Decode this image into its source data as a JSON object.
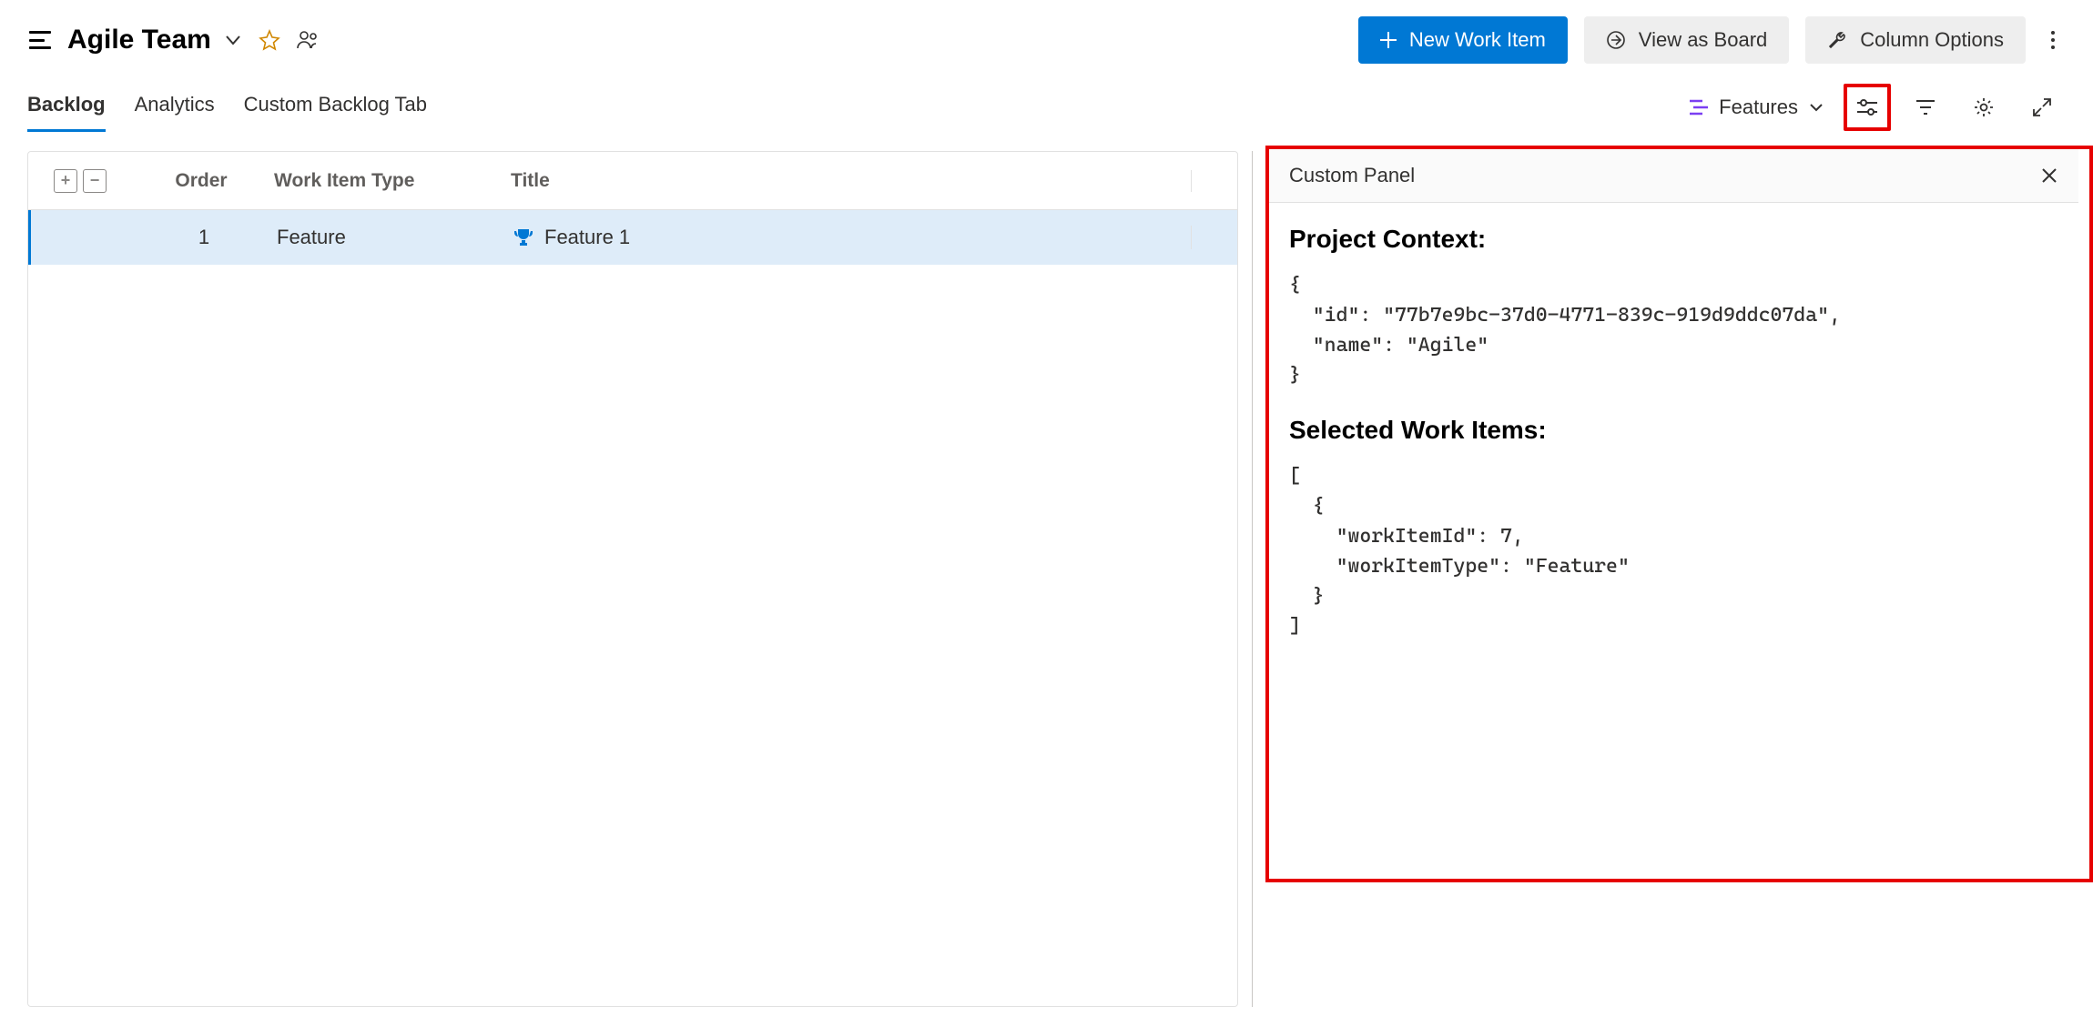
{
  "header": {
    "team_name": "Agile Team",
    "buttons": {
      "new_work_item": "New Work Item",
      "view_as_board": "View as Board",
      "column_options": "Column Options"
    }
  },
  "tabs": {
    "backlog": "Backlog",
    "analytics": "Analytics",
    "custom": "Custom Backlog Tab"
  },
  "level_picker": "Features",
  "grid": {
    "headers": {
      "order": "Order",
      "type": "Work Item Type",
      "title": "Title"
    },
    "rows": [
      {
        "order": "1",
        "type": "Feature",
        "title": "Feature 1"
      }
    ]
  },
  "panel": {
    "title": "Custom Panel",
    "section1_title": "Project Context:",
    "section1_code": "{\n  \"id\": \"77b7e9bc-37d0-4771-839c-919d9ddc07da\",\n  \"name\": \"Agile\"\n}",
    "section2_title": "Selected Work Items:",
    "section2_code": "[\n  {\n    \"workItemId\": 7,\n    \"workItemType\": \"Feature\"\n  }\n]"
  }
}
